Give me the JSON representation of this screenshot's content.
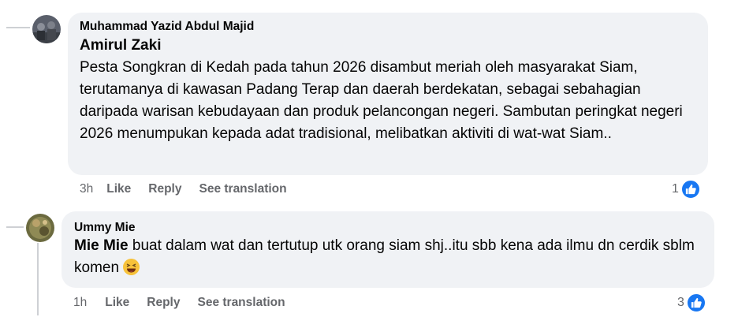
{
  "comments": [
    {
      "author": "Muhammad Yazid Abdul Majid",
      "mention": "Amirul Zaki",
      "text": "Pesta Songkran di Kedah pada tahun 2026 disambut meriah oleh masyarakat Siam, terutamanya di kawasan Padang Terap dan daerah berdekatan, sebagai sebahagian daripada warisan kebudayaan dan produk pelancongan negeri. Sambutan peringkat negeri 2026 menumpukan kepada adat tradisional, melibatkan aktiviti di wat-wat Siam..",
      "time": "3h",
      "like_label": "Like",
      "reply_label": "Reply",
      "translate_label": "See translation",
      "reaction_count": "1",
      "reaction_icon": "like-thumb-icon"
    },
    {
      "author": "Ummy Mie",
      "mention": "Mie Mie",
      "text": "buat dalam wat dan tertutup utk orang siam shj..itu sbb kena ada ilmu dn cerdik sblm komen",
      "emoji": "grinning-squinting-face-emoji",
      "time": "1h",
      "like_label": "Like",
      "reply_label": "Reply",
      "translate_label": "See translation",
      "reaction_count": "3",
      "reaction_icon": "like-thumb-icon"
    }
  ],
  "colors": {
    "bubble": "#f0f2f5",
    "secondary_text": "#65676b",
    "like_blue": "#1877f2",
    "thread_line": "#ced0d4"
  }
}
